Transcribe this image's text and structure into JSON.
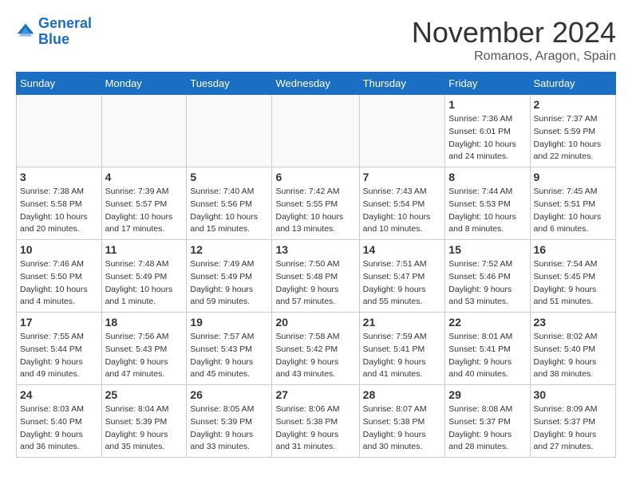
{
  "header": {
    "logo_line1": "General",
    "logo_line2": "Blue",
    "month_title": "November 2024",
    "location": "Romanos, Aragon, Spain"
  },
  "days_of_week": [
    "Sunday",
    "Monday",
    "Tuesday",
    "Wednesday",
    "Thursday",
    "Friday",
    "Saturday"
  ],
  "weeks": [
    [
      {
        "day": "",
        "info": ""
      },
      {
        "day": "",
        "info": ""
      },
      {
        "day": "",
        "info": ""
      },
      {
        "day": "",
        "info": ""
      },
      {
        "day": "",
        "info": ""
      },
      {
        "day": "1",
        "info": "Sunrise: 7:36 AM\nSunset: 6:01 PM\nDaylight: 10 hours\nand 24 minutes."
      },
      {
        "day": "2",
        "info": "Sunrise: 7:37 AM\nSunset: 5:59 PM\nDaylight: 10 hours\nand 22 minutes."
      }
    ],
    [
      {
        "day": "3",
        "info": "Sunrise: 7:38 AM\nSunset: 5:58 PM\nDaylight: 10 hours\nand 20 minutes."
      },
      {
        "day": "4",
        "info": "Sunrise: 7:39 AM\nSunset: 5:57 PM\nDaylight: 10 hours\nand 17 minutes."
      },
      {
        "day": "5",
        "info": "Sunrise: 7:40 AM\nSunset: 5:56 PM\nDaylight: 10 hours\nand 15 minutes."
      },
      {
        "day": "6",
        "info": "Sunrise: 7:42 AM\nSunset: 5:55 PM\nDaylight: 10 hours\nand 13 minutes."
      },
      {
        "day": "7",
        "info": "Sunrise: 7:43 AM\nSunset: 5:54 PM\nDaylight: 10 hours\nand 10 minutes."
      },
      {
        "day": "8",
        "info": "Sunrise: 7:44 AM\nSunset: 5:53 PM\nDaylight: 10 hours\nand 8 minutes."
      },
      {
        "day": "9",
        "info": "Sunrise: 7:45 AM\nSunset: 5:51 PM\nDaylight: 10 hours\nand 6 minutes."
      }
    ],
    [
      {
        "day": "10",
        "info": "Sunrise: 7:46 AM\nSunset: 5:50 PM\nDaylight: 10 hours\nand 4 minutes."
      },
      {
        "day": "11",
        "info": "Sunrise: 7:48 AM\nSunset: 5:49 PM\nDaylight: 10 hours\nand 1 minute."
      },
      {
        "day": "12",
        "info": "Sunrise: 7:49 AM\nSunset: 5:49 PM\nDaylight: 9 hours\nand 59 minutes."
      },
      {
        "day": "13",
        "info": "Sunrise: 7:50 AM\nSunset: 5:48 PM\nDaylight: 9 hours\nand 57 minutes."
      },
      {
        "day": "14",
        "info": "Sunrise: 7:51 AM\nSunset: 5:47 PM\nDaylight: 9 hours\nand 55 minutes."
      },
      {
        "day": "15",
        "info": "Sunrise: 7:52 AM\nSunset: 5:46 PM\nDaylight: 9 hours\nand 53 minutes."
      },
      {
        "day": "16",
        "info": "Sunrise: 7:54 AM\nSunset: 5:45 PM\nDaylight: 9 hours\nand 51 minutes."
      }
    ],
    [
      {
        "day": "17",
        "info": "Sunrise: 7:55 AM\nSunset: 5:44 PM\nDaylight: 9 hours\nand 49 minutes."
      },
      {
        "day": "18",
        "info": "Sunrise: 7:56 AM\nSunset: 5:43 PM\nDaylight: 9 hours\nand 47 minutes."
      },
      {
        "day": "19",
        "info": "Sunrise: 7:57 AM\nSunset: 5:43 PM\nDaylight: 9 hours\nand 45 minutes."
      },
      {
        "day": "20",
        "info": "Sunrise: 7:58 AM\nSunset: 5:42 PM\nDaylight: 9 hours\nand 43 minutes."
      },
      {
        "day": "21",
        "info": "Sunrise: 7:59 AM\nSunset: 5:41 PM\nDaylight: 9 hours\nand 41 minutes."
      },
      {
        "day": "22",
        "info": "Sunrise: 8:01 AM\nSunset: 5:41 PM\nDaylight: 9 hours\nand 40 minutes."
      },
      {
        "day": "23",
        "info": "Sunrise: 8:02 AM\nSunset: 5:40 PM\nDaylight: 9 hours\nand 38 minutes."
      }
    ],
    [
      {
        "day": "24",
        "info": "Sunrise: 8:03 AM\nSunset: 5:40 PM\nDaylight: 9 hours\nand 36 minutes."
      },
      {
        "day": "25",
        "info": "Sunrise: 8:04 AM\nSunset: 5:39 PM\nDaylight: 9 hours\nand 35 minutes."
      },
      {
        "day": "26",
        "info": "Sunrise: 8:05 AM\nSunset: 5:39 PM\nDaylight: 9 hours\nand 33 minutes."
      },
      {
        "day": "27",
        "info": "Sunrise: 8:06 AM\nSunset: 5:38 PM\nDaylight: 9 hours\nand 31 minutes."
      },
      {
        "day": "28",
        "info": "Sunrise: 8:07 AM\nSunset: 5:38 PM\nDaylight: 9 hours\nand 30 minutes."
      },
      {
        "day": "29",
        "info": "Sunrise: 8:08 AM\nSunset: 5:37 PM\nDaylight: 9 hours\nand 28 minutes."
      },
      {
        "day": "30",
        "info": "Sunrise: 8:09 AM\nSunset: 5:37 PM\nDaylight: 9 hours\nand 27 minutes."
      }
    ]
  ]
}
